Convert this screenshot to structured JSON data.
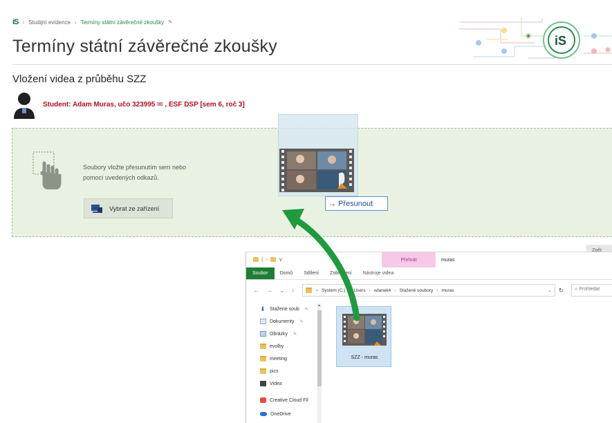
{
  "breadcrumb": {
    "logo": "iS",
    "items": [
      "Studijní evidence",
      "Termíny státní závěrečné zkoušky"
    ]
  },
  "page": {
    "title": "Termíny státní závěrečné zkoušky",
    "section_heading": "Vložení videa z průběhu SZZ"
  },
  "student": {
    "label": "Student: Adam Muras, učo 323995",
    "program": ", ESF DSP [sem 6, roč 3]"
  },
  "upload": {
    "instructions_line1": "Soubory vložte přesunutím sem nebo",
    "instructions_line2": "pomocí uvedených odkazů.",
    "select_button": "Vybrat ze zařízení"
  },
  "side_tab": {
    "label": "Zpět"
  },
  "drag": {
    "move_label": "Přesunout"
  },
  "explorer": {
    "qat_marker": "∨",
    "contextual_tab": "Přehrát",
    "window_title": "muras",
    "ribbon_tabs": [
      "Soubor",
      "Domů",
      "Sdílení",
      "Zobrazení",
      "Nástroje videa"
    ],
    "address_segments": [
      "System (C:)",
      "Users",
      "xdanek4",
      "Stažené soubory",
      "muras"
    ],
    "search_placeholder": "Prohledat",
    "nav_items": [
      {
        "label": "Stažené soub",
        "pinned": true
      },
      {
        "label": "Dokumenty",
        "pinned": true
      },
      {
        "label": "Obrázky",
        "pinned": true
      },
      {
        "label": "evolby",
        "pinned": false
      },
      {
        "label": "meeting",
        "pinned": false
      },
      {
        "label": "pics",
        "pinned": false
      },
      {
        "label": "Videa",
        "pinned": false
      },
      {
        "label": "Creative Cloud Fil",
        "pinned": false
      },
      {
        "label": "OneDrive",
        "pinned": false
      }
    ],
    "file": {
      "name": "SZZ - muras"
    }
  },
  "colors": {
    "green_accent": "#1f8a3a",
    "drop_zone_bg": "#e9f2e2",
    "student_red": "#b01020",
    "ribbon_file_green": "#1e7e34"
  }
}
